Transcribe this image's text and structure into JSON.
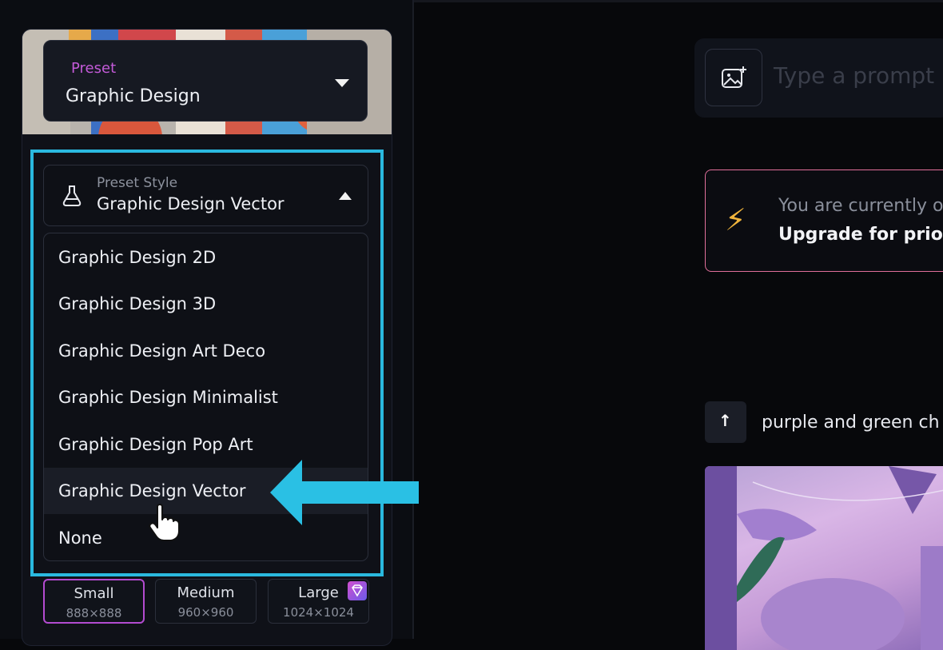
{
  "preset": {
    "label": "Preset",
    "value": "Graphic Design"
  },
  "preset_style": {
    "label": "Preset Style",
    "value": "Graphic Design Vector",
    "options": [
      "Graphic Design 2D",
      "Graphic Design 3D",
      "Graphic Design Art Deco",
      "Graphic Design Minimalist",
      "Graphic Design Pop Art",
      "Graphic Design Vector",
      "None"
    ],
    "selected_index": 5
  },
  "sizes": [
    {
      "name": "Small",
      "dims": "888×888",
      "active": true
    },
    {
      "name": "Medium",
      "dims": "960×960",
      "active": false
    },
    {
      "name": "Large",
      "dims": "1024×1024",
      "active": false,
      "premium": true
    }
  ],
  "prompt": {
    "placeholder": "Type a prompt ..."
  },
  "notice": {
    "line1": "You are currently o",
    "line2": "Upgrade for priori"
  },
  "history": {
    "prompt_text": "purple and green ch"
  },
  "colors": {
    "accent_highlight": "#2ab9df",
    "preset_label": "#c35ad8",
    "notice_border": "#e06f9a",
    "active_size_border": "#b34bd0"
  }
}
